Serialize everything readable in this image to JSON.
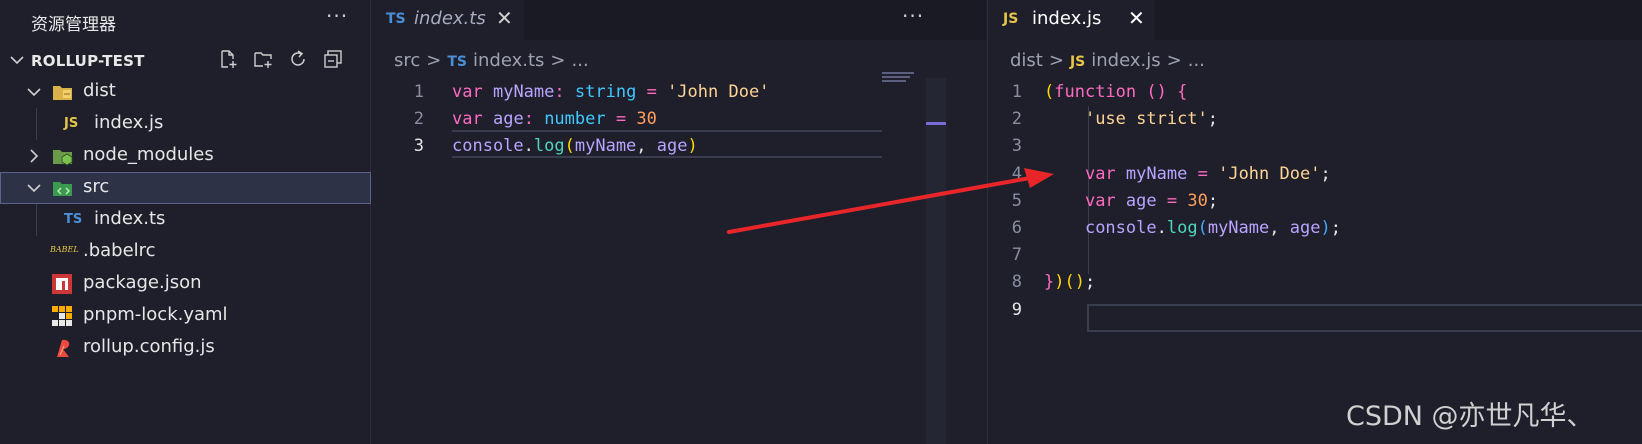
{
  "explorer": {
    "title": "资源管理器",
    "more_label": "···",
    "project_name": "ROLLUP-TEST",
    "actions": [
      "new-file-icon",
      "new-folder-icon",
      "refresh-icon",
      "collapse-all-icon"
    ],
    "tree": [
      {
        "name": "dist",
        "kind": "folder",
        "icon": "folder-dist-icon",
        "expanded": true
      },
      {
        "name": "index.js",
        "kind": "file",
        "icon": "js-file-icon",
        "icon_text": "JS"
      },
      {
        "name": "node_modules",
        "kind": "folder",
        "icon": "folder-node-icon",
        "expanded": false
      },
      {
        "name": "src",
        "kind": "folder",
        "icon": "folder-src-icon",
        "expanded": true,
        "selected": true
      },
      {
        "name": "index.ts",
        "kind": "file",
        "icon": "ts-file-icon",
        "icon_text": "TS"
      },
      {
        "name": ".babelrc",
        "kind": "file",
        "icon": "babel-icon",
        "icon_text": "BABEL"
      },
      {
        "name": "package.json",
        "kind": "file",
        "icon": "npm-icon"
      },
      {
        "name": "pnpm-lock.yaml",
        "kind": "file",
        "icon": "pnpm-icon"
      },
      {
        "name": "rollup.config.js",
        "kind": "file",
        "icon": "rollup-icon"
      }
    ]
  },
  "left_editor": {
    "tab": {
      "type": "TS",
      "name": "index.ts",
      "close": "✕"
    },
    "more_label": "···",
    "breadcrumb": {
      "folder": "src",
      "sep": ">",
      "file_type": "TS",
      "file": "index.ts",
      "tail": "..."
    },
    "line_numbers": [
      "1",
      "2",
      "3"
    ],
    "lines": [
      [
        [
          "kw",
          "var"
        ],
        [
          "pl",
          " "
        ],
        [
          "var",
          "myName"
        ],
        [
          "op",
          ":"
        ],
        [
          "pl",
          " "
        ],
        [
          "ty",
          "string"
        ],
        [
          "pl",
          " "
        ],
        [
          "op",
          "="
        ],
        [
          "pl",
          " "
        ],
        [
          "str",
          "'John Doe'"
        ]
      ],
      [
        [
          "kw",
          "var"
        ],
        [
          "pl",
          " "
        ],
        [
          "var",
          "age"
        ],
        [
          "op",
          ":"
        ],
        [
          "pl",
          " "
        ],
        [
          "ty",
          "number"
        ],
        [
          "pl",
          " "
        ],
        [
          "op",
          "="
        ],
        [
          "pl",
          " "
        ],
        [
          "num",
          "30"
        ]
      ],
      [
        [
          "var",
          "console"
        ],
        [
          "pl",
          "."
        ],
        [
          "prop",
          "log"
        ],
        [
          "par1",
          "("
        ],
        [
          "var",
          "myName"
        ],
        [
          "pl",
          ", "
        ],
        [
          "var",
          "age"
        ],
        [
          "par1",
          ")"
        ]
      ]
    ]
  },
  "right_editor": {
    "tab": {
      "type": "JS",
      "name": "index.js",
      "close": "✕"
    },
    "breadcrumb": {
      "folder": "dist",
      "sep": ">",
      "file_type": "JS",
      "file": "index.js",
      "tail": "..."
    },
    "line_numbers": [
      "1",
      "2",
      "3",
      "4",
      "5",
      "6",
      "7",
      "8",
      "9"
    ],
    "lines": [
      [
        [
          "par1",
          "("
        ],
        [
          "kw",
          "function"
        ],
        [
          "pl",
          " "
        ],
        [
          "par2",
          "()"
        ],
        [
          "pl",
          " "
        ],
        [
          "par2",
          "{"
        ]
      ],
      [
        [
          "pl",
          "    "
        ],
        [
          "str",
          "'use strict'"
        ],
        [
          "pl",
          ";"
        ]
      ],
      [],
      [
        [
          "pl",
          "    "
        ],
        [
          "kw",
          "var"
        ],
        [
          "pl",
          " "
        ],
        [
          "var",
          "myName"
        ],
        [
          "pl",
          " "
        ],
        [
          "op",
          "="
        ],
        [
          "pl",
          " "
        ],
        [
          "str",
          "'John Doe'"
        ],
        [
          "pl",
          ";"
        ]
      ],
      [
        [
          "pl",
          "    "
        ],
        [
          "kw",
          "var"
        ],
        [
          "pl",
          " "
        ],
        [
          "var",
          "age"
        ],
        [
          "pl",
          " "
        ],
        [
          "op",
          "="
        ],
        [
          "pl",
          " "
        ],
        [
          "num",
          "30"
        ],
        [
          "pl",
          ";"
        ]
      ],
      [
        [
          "pl",
          "    "
        ],
        [
          "var",
          "console"
        ],
        [
          "pl",
          "."
        ],
        [
          "prop",
          "log"
        ],
        [
          "par3",
          "("
        ],
        [
          "var",
          "myName"
        ],
        [
          "pl",
          ", "
        ],
        [
          "var",
          "age"
        ],
        [
          "par3",
          ")"
        ],
        [
          "pl",
          ";"
        ]
      ],
      [],
      [
        [
          "par2",
          "}"
        ],
        [
          "par1",
          ")"
        ],
        [
          "par1",
          "()"
        ],
        [
          "pl",
          ";"
        ]
      ],
      []
    ]
  },
  "watermark": "CSDN @亦世凡华、",
  "colors": {
    "background": "#1e1f2b",
    "arrow": "#e8262a",
    "keyword": "#ff6ac1",
    "string": "#ffd494",
    "number": "#ff9f5a",
    "variable": "#b9a4ff"
  }
}
